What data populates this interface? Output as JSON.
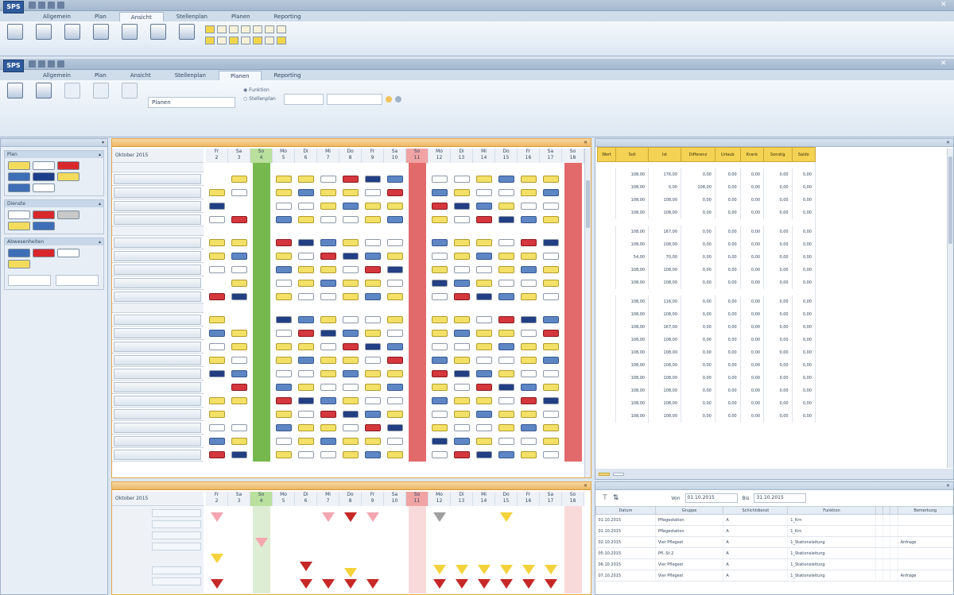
{
  "app": {
    "logo": "SPS",
    "tabs_top": [
      "Allgemein",
      "Plan",
      "Ansicht",
      "Stellenplan",
      "Planen",
      "Reporting"
    ],
    "tabs_second": [
      "Allgemein",
      "Plan",
      "Ansicht",
      "Stellenplan",
      "Planen",
      "Reporting"
    ],
    "active_top": "Ansicht",
    "active_second": "Planen"
  },
  "ribbon2": {
    "search_field": "Planen",
    "radio_1": "Funktion",
    "radio_2": "Stellenplan",
    "colors": {
      "accent": "#f2c45a",
      "weekend": "#e36a6a",
      "holiday": "#76b84e"
    }
  },
  "left_panel": {
    "sections": [
      "Plan",
      "Dienste",
      "Abwesenheiten"
    ]
  },
  "main_grid": {
    "month": "Oktober 2015",
    "days": [
      {
        "wd": "Fr",
        "d": "2"
      },
      {
        "wd": "Sa",
        "d": "3"
      },
      {
        "wd": "So",
        "d": "4"
      },
      {
        "wd": "Mo",
        "d": "5"
      },
      {
        "wd": "Di",
        "d": "6"
      },
      {
        "wd": "Mi",
        "d": "7"
      },
      {
        "wd": "Do",
        "d": "8"
      },
      {
        "wd": "Fr",
        "d": "9"
      },
      {
        "wd": "Sa",
        "d": "10"
      },
      {
        "wd": "So",
        "d": "11"
      },
      {
        "wd": "Mo",
        "d": "12"
      },
      {
        "wd": "Di",
        "d": "13"
      },
      {
        "wd": "Mi",
        "d": "14"
      },
      {
        "wd": "Do",
        "d": "15"
      },
      {
        "wd": "Fr",
        "d": "16"
      },
      {
        "wd": "Sa",
        "d": "17"
      },
      {
        "wd": "So",
        "d": "18"
      }
    ]
  },
  "bottom_grid": {
    "month": "Oktober 2015"
  },
  "right_panel": {
    "columns": [
      "Wert",
      "Soll",
      "Ist",
      "Differenz",
      "Urlaub",
      "Krank",
      "Sonstig",
      "Saldo"
    ],
    "blocks": [
      [
        [
          "108,00",
          "176,00",
          "0,00",
          "0,00",
          "0,00",
          "0,00",
          "0,00"
        ],
        [
          "108,00",
          "0,00",
          "108,00",
          "0,00",
          "0,00",
          "0,00",
          "0,00"
        ],
        [
          "108,00",
          "108,00",
          "0,00",
          "0,00",
          "0,00",
          "0,00",
          "0,00"
        ],
        [
          "108,00",
          "108,00",
          "0,00",
          "0,00",
          "0,00",
          "0,00",
          "0,00"
        ]
      ],
      [
        [
          "108,00",
          "167,00",
          "0,00",
          "0,00",
          "0,00",
          "0,00",
          "0,00"
        ],
        [
          "108,00",
          "108,00",
          "0,00",
          "0,00",
          "0,00",
          "0,00",
          "0,00"
        ],
        [
          "54,00",
          "70,00",
          "0,00",
          "0,00",
          "0,00",
          "0,00",
          "0,00"
        ],
        [
          "108,00",
          "108,00",
          "0,00",
          "0,00",
          "0,00",
          "0,00",
          "0,00"
        ],
        [
          "108,00",
          "108,00",
          "0,00",
          "0,00",
          "0,00",
          "0,00",
          "0,00"
        ]
      ],
      [
        [
          "108,00",
          "116,00",
          "0,00",
          "0,00",
          "0,00",
          "0,00",
          "0,00"
        ],
        [
          "108,00",
          "108,00",
          "0,00",
          "0,00",
          "0,00",
          "0,00",
          "0,00"
        ],
        [
          "108,00",
          "167,00",
          "0,00",
          "0,00",
          "0,00",
          "0,00",
          "0,00"
        ],
        [
          "108,00",
          "108,00",
          "0,00",
          "0,00",
          "0,00",
          "0,00",
          "0,00"
        ],
        [
          "108,00",
          "108,00",
          "0,00",
          "0,00",
          "0,00",
          "0,00",
          "0,00"
        ],
        [
          "108,00",
          "108,00",
          "0,00",
          "0,00",
          "0,00",
          "0,00",
          "0,00"
        ],
        [
          "108,00",
          "108,00",
          "0,00",
          "0,00",
          "0,00",
          "0,00",
          "0,00"
        ],
        [
          "108,00",
          "108,00",
          "0,00",
          "0,00",
          "0,00",
          "0,00",
          "0,00"
        ],
        [
          "108,00",
          "108,00",
          "0,00",
          "0,00",
          "0,00",
          "0,00",
          "0,00"
        ],
        [
          "108,00",
          "108,00",
          "0,00",
          "0,00",
          "0,00",
          "0,00",
          "0,00"
        ]
      ]
    ]
  },
  "bottom_right": {
    "von_label": "Von",
    "bis_label": "Bis",
    "von_value": "01.10.2015",
    "bis_value": "31.10.2015",
    "columns": [
      "Datum",
      "Gruppe",
      "Schichtdienst",
      "Funktion",
      "",
      "",
      "",
      "Bemerkung"
    ],
    "rows": [
      [
        "01.10.2015",
        "Pflegestation",
        "A",
        "1_Krn",
        "",
        "",
        "",
        ""
      ],
      [
        "01.10.2015",
        "Pflegestation",
        "A",
        "1_Krn",
        "",
        "",
        "",
        ""
      ],
      [
        "02.10.2015",
        "Vier Pflegest",
        "A",
        "1_Stationsleitung",
        "",
        "",
        "",
        "Anfrage"
      ],
      [
        "05.10.2015",
        "Pfl.-St.2",
        "A",
        "1_Stationsleitung",
        "",
        "",
        "",
        ""
      ],
      [
        "06.10.2015",
        "Vier Pflegest",
        "A",
        "1_Stationsleitung",
        "",
        "",
        "",
        ""
      ],
      [
        "07.10.2015",
        "Vier Pflegest",
        "A",
        "1_Stationsleitung",
        "",
        "",
        "",
        "Anfrage"
      ]
    ]
  }
}
